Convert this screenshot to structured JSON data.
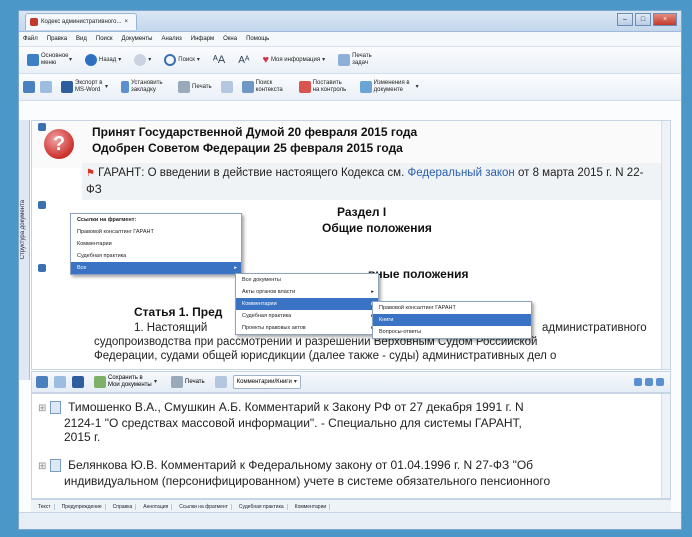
{
  "window": {
    "tab_title": "Кодекс административного..."
  },
  "menu": [
    "Файл",
    "Правка",
    "Вид",
    "Поиск",
    "Документы",
    "Анализ",
    "Инфарм",
    "Окна",
    "Помощь"
  ],
  "toolbar1": {
    "basic": "Основное меню",
    "back": "Назад",
    "search": "Поиск",
    "my_info": "Моя информация",
    "print_tasks": "Печать задач"
  },
  "toolbar2": {
    "export_word": "Экспорт в MS-Word",
    "bookmark": "Установить закладку",
    "print": "Печать",
    "context_search": "Поиск контекста",
    "control": "Поставить на контроль",
    "changes": "Изменения в документе"
  },
  "document": {
    "line1": "Принят Государственной Думой 20 февраля 2015 года",
    "line2": "Одобрен Советом Федерации 25 февраля 2015 года",
    "garant_text": "ГАРАНТ: О введении в действие настоящего Кодекса см.",
    "garant_link": "Федеральный закон",
    "garant_tail": "от 8 марта 2015 г. N 22-ФЗ",
    "section_title": "Раздел I",
    "section_subtitle": "Общие положения",
    "chapter_partial": "вные положения",
    "article": "Статья 1. Пред",
    "para1a": "1. Настоящий",
    "para1b": "административного",
    "para2": "судопроизводства при рассмотрении и разрешении Верховным Судом Российской",
    "para3": "Федерации, судами общей юрисдикции (далее также - суды) административных дел о"
  },
  "context_menu": {
    "items": [
      "Ссылки на фрагмент:",
      "Правовой консалтинг ГАРАНТ",
      "Комментарии",
      "Судебная практика",
      "Все"
    ]
  },
  "submenu1": {
    "items": [
      "Все документы",
      "Акты органов власти",
      "Комментарии",
      "Судебная практика",
      "Проекты правовых актов"
    ]
  },
  "submenu2": {
    "items": [
      "Правовой консалтинг ГАРАНТ",
      "Книги",
      "Вопросы-ответы"
    ]
  },
  "lower_toolbar": {
    "save": "Сохранить в Мои документы",
    "print": "Печать",
    "filter": "Комментарии/Книги"
  },
  "lower_list": [
    {
      "l1": "Тимошенко В.А., Смушкин А.Б. Комментарий к Закону РФ от 27 декабря 1991 г. N",
      "l2": "2124-1 \"О средствах массовой информации\". - Специально для системы ГАРАНТ,",
      "l3": "2015 г."
    },
    {
      "l1": "Белянкова Ю.В. Комментарий к Федеральному закону от 01.04.1996 г. N 27-ФЗ \"Об",
      "l2": "индивидуальном (персонифицированном) учете в системе обязательного пенсионного"
    }
  ],
  "bottom_tabs": [
    "Текст",
    "Предупреждение",
    "Справка",
    "Аннотация",
    "Ссылки на фрагмент",
    "Судебная практика",
    "Комментарии"
  ],
  "side_tab": "Структура документа",
  "colors": {
    "accent": "#3a72c4",
    "link": "#2a5db0",
    "warn": "#c9302c"
  }
}
